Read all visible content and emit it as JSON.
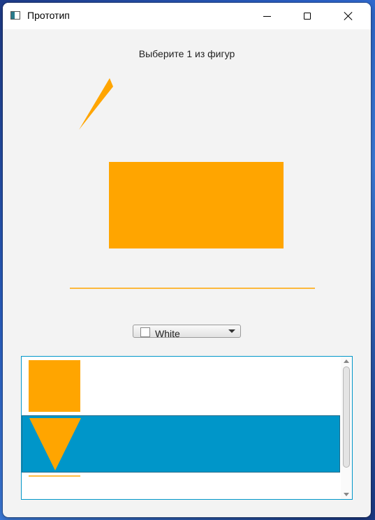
{
  "window": {
    "title": "Прототип"
  },
  "prompt": "Выберите 1 из фигур",
  "colors": {
    "shape_fill": "#FFA500",
    "selection": "#0096C9",
    "background": "#F3F3F3"
  },
  "shapes": [
    "triangle",
    "rectangle",
    "line"
  ],
  "color_select": {
    "selected": "White",
    "swatch_color": "#FFFFFF"
  },
  "list": {
    "items": [
      "square",
      "triangle",
      "line"
    ],
    "selected_index": 1
  },
  "icons": {
    "app": "app-window-icon",
    "minimize": "minimize-icon",
    "maximize": "maximize-icon",
    "close": "close-icon",
    "dropdown": "chevron-down-icon"
  }
}
